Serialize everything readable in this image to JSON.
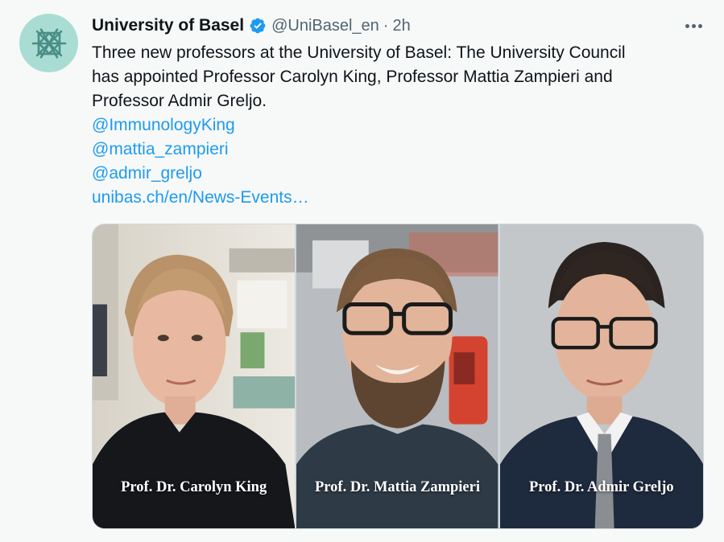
{
  "account": {
    "display_name": "University of Basel",
    "handle": "@UniBasel_en",
    "separator": "·",
    "time": "2h",
    "avatar_icon": "snowflake-logo-icon",
    "verified_icon": "verified-badge-icon",
    "avatar_bg": "#a9ddd3",
    "logo_color": "#4a8f87"
  },
  "tweet": {
    "text_lines": [
      "Three new professors at the University of Basel: The University Council",
      "has appointed Professor Carolyn King, Professor Mattia Zampieri and",
      "Professor Admir Greljo."
    ],
    "mentions": [
      "@ImmunologyKing",
      "@mattia_zampieri",
      "@admir_greljo"
    ],
    "link": "unibas.ch/en/News-Events…",
    "link_color": "#1d9bf0"
  },
  "media": {
    "captions": [
      "Prof. Dr. Carolyn King",
      "Prof. Dr. Mattia Zampieri",
      "Prof. Dr. Admir Greljo"
    ]
  },
  "more_icon": "more-options-icon"
}
